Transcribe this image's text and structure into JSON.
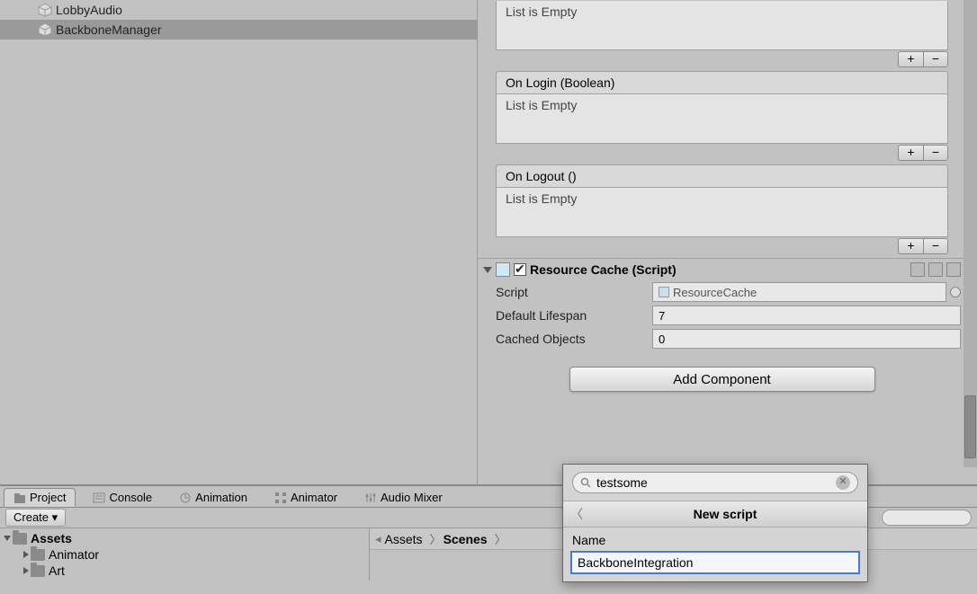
{
  "hierarchy": {
    "items": [
      {
        "name": "LobbyAudio",
        "selected": false
      },
      {
        "name": "BackboneManager",
        "selected": true
      }
    ]
  },
  "events": [
    {
      "header": "",
      "body": "List is Empty"
    },
    {
      "header": "On Login (Boolean)",
      "body": "List is Empty"
    },
    {
      "header": "On Logout ()",
      "body": "List is Empty"
    }
  ],
  "component": {
    "title": "Resource Cache (Script)",
    "rows": {
      "script": {
        "label": "Script",
        "value": "ResourceCache"
      },
      "lifespan": {
        "label": "Default Lifespan",
        "value": "7"
      },
      "cached": {
        "label": "Cached Objects",
        "value": "0"
      }
    }
  },
  "addComponent": "Add Component",
  "tabs": {
    "project": "Project",
    "console": "Console",
    "animation": "Animation",
    "animator": "Animator",
    "audiomixer": "Audio Mixer"
  },
  "toolbar": {
    "create": "Create"
  },
  "folders": {
    "root": "Assets",
    "children": [
      "Animator",
      "Art"
    ]
  },
  "breadcrumb": {
    "a": "Assets",
    "b": "Scenes"
  },
  "popup": {
    "search": "testsome",
    "title": "New script",
    "nameLabel": "Name",
    "nameValue": "BackboneIntegration"
  },
  "glyphs": {
    "plus": "+",
    "minus": "−"
  }
}
